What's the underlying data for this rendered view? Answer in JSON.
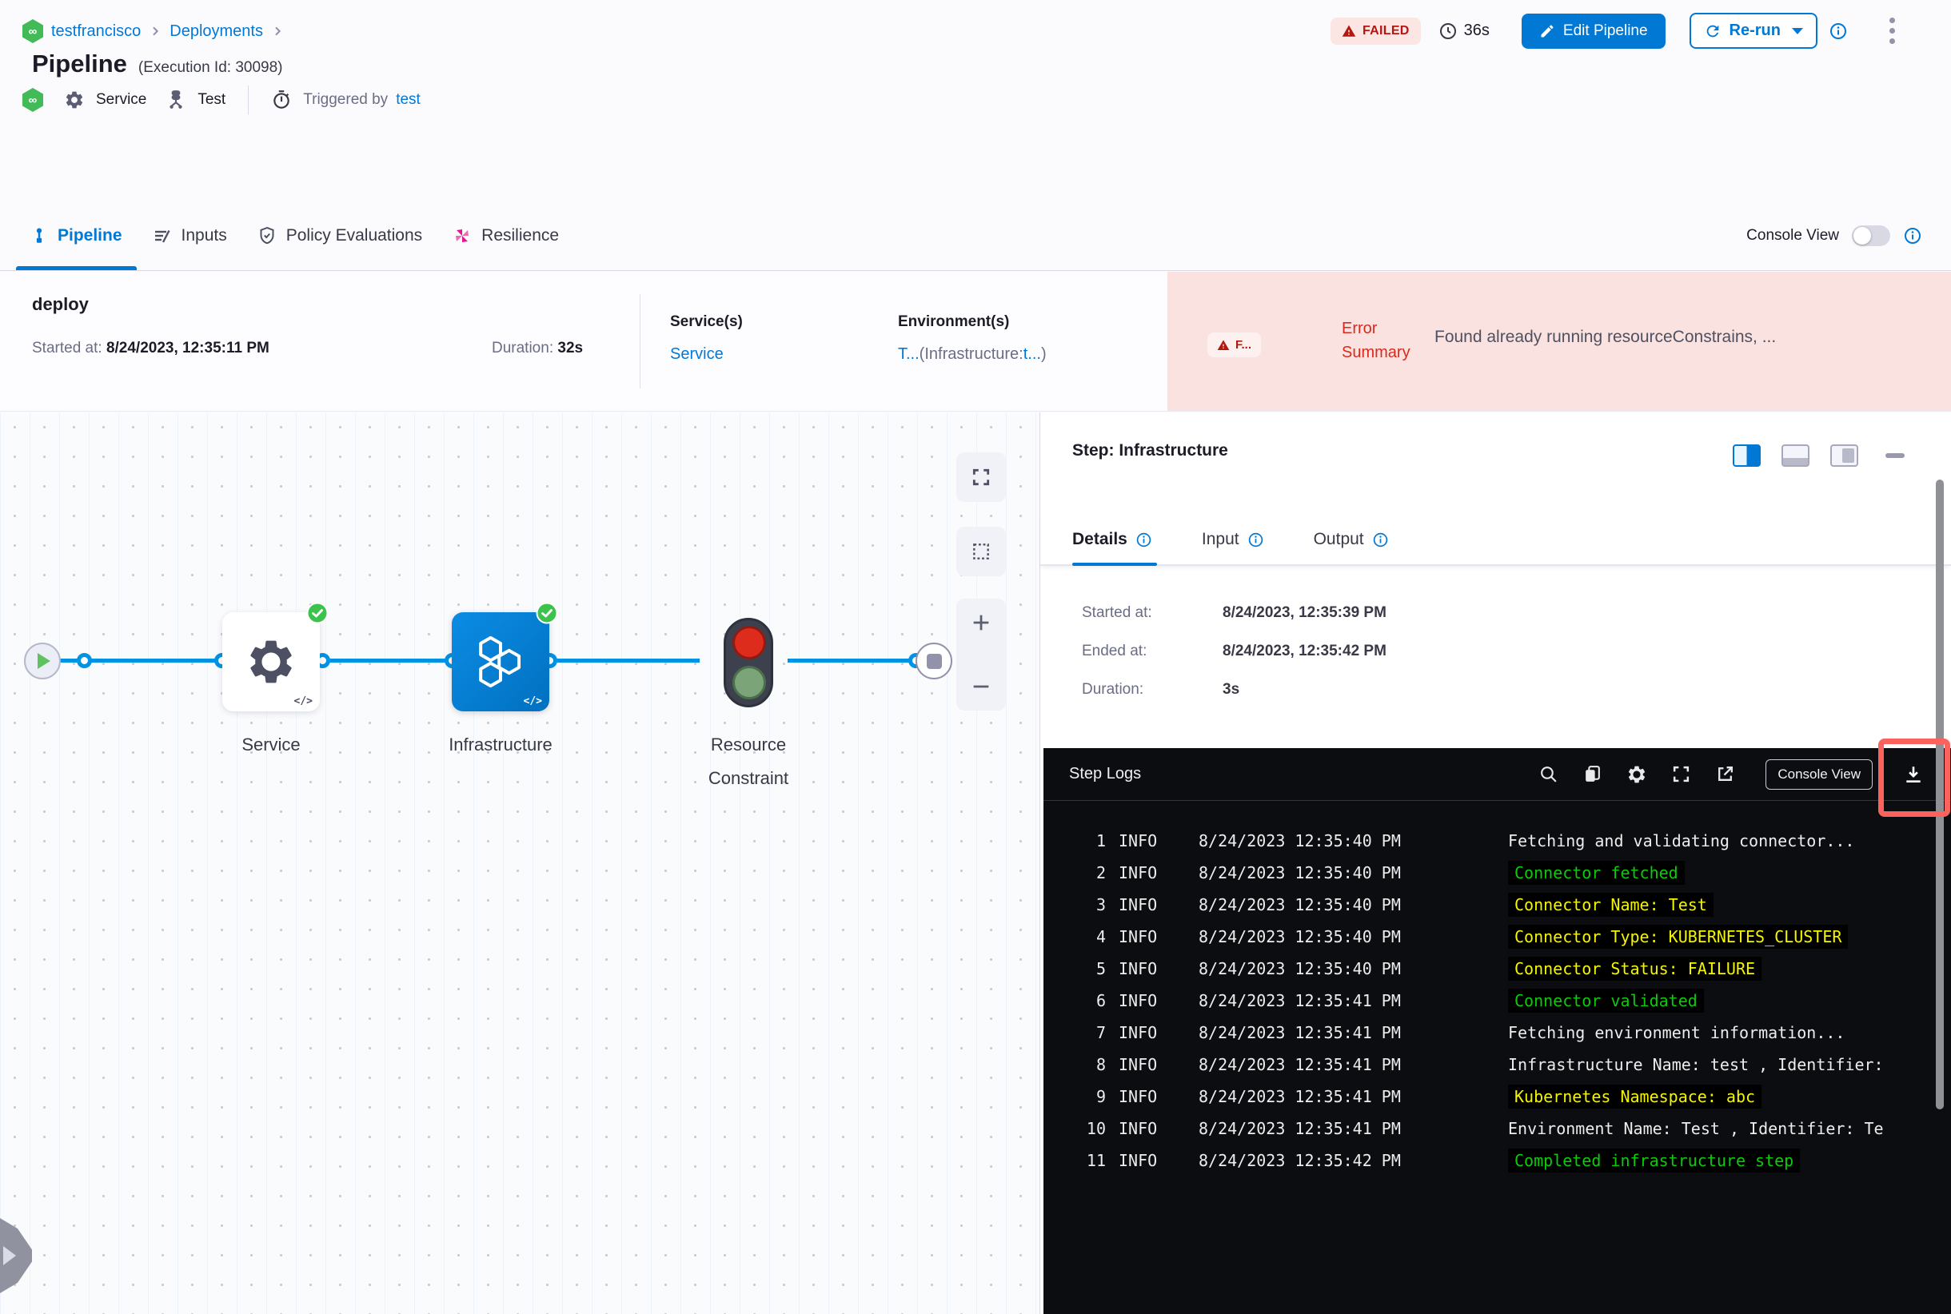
{
  "colors": {
    "primary_blue": "#0278d5",
    "edge_blue": "#0092e4",
    "failed_red": "#b41710",
    "failed_bg": "#fbe6e4",
    "error_region_bg": "#f9e2df",
    "success_green": "#3dc34d",
    "harness_green": "#42ba57",
    "resilience_pink": "#e1158c",
    "console_bg": "#0b0d10",
    "console_green": "#0acc0a",
    "console_yellow": "#f5f500",
    "annotation_red": "#f9625d"
  },
  "breadcrumb": {
    "project": "testfrancisco",
    "section": "Deployments",
    "infinity_glyph": "∞"
  },
  "header": {
    "title": "Pipeline",
    "execution_id": "(Execution Id: 30098)",
    "status": "FAILED",
    "elapsed": "36s",
    "edit_button": "Edit Pipeline",
    "rerun_button": "Re-run",
    "service_label": "Service",
    "test_label": "Test",
    "triggered_by_label": "Triggered by",
    "triggered_by_user": "test"
  },
  "tabs": [
    {
      "label": "Pipeline"
    },
    {
      "label": "Inputs"
    },
    {
      "label": "Policy Evaluations"
    },
    {
      "label": "Resilience"
    }
  ],
  "console_view_label": "Console View",
  "summary": {
    "stage_name": "deploy",
    "started_label": "Started at:",
    "started_value": "8/24/2023, 12:35:11 PM",
    "duration_label": "Duration:",
    "duration_value": "32s",
    "services_label": "Service(s)",
    "services_value": "Service",
    "environments_label": "Environment(s)",
    "env_value_prefix": "T...",
    "env_value_mid": "(Infrastructure:",
    "env_value_link": "t...",
    "env_value_suffix": ")",
    "failed_short": "F...",
    "error_summary_label": "Error Summary",
    "error_summary_text": "Found already running resourceConstrains, ..."
  },
  "graph": {
    "nodes": [
      {
        "label": "Service"
      },
      {
        "label": "Infrastructure"
      },
      {
        "label": "Resource Constraint"
      }
    ],
    "code_glyph": "</>"
  },
  "step_panel": {
    "title": "Step: Infrastructure",
    "tabs": [
      {
        "label": "Details"
      },
      {
        "label": "Input"
      },
      {
        "label": "Output"
      }
    ],
    "details": {
      "started_label": "Started at:",
      "started_value": "8/24/2023, 12:35:39 PM",
      "ended_label": "Ended at:",
      "ended_value": "8/24/2023, 12:35:42 PM",
      "duration_label": "Duration:",
      "duration_value": "3s"
    },
    "logs_title": "Step Logs",
    "console_view_button": "Console View",
    "logs": [
      {
        "n": "1",
        "level": "INFO",
        "ts": "8/24/2023 12:35:40 PM",
        "msg": "Fetching and validating connector...",
        "color": "white"
      },
      {
        "n": "2",
        "level": "INFO",
        "ts": "8/24/2023 12:35:40 PM",
        "msg": "Connector fetched",
        "color": "green"
      },
      {
        "n": "3",
        "level": "INFO",
        "ts": "8/24/2023 12:35:40 PM",
        "msg": "Connector Name: Test",
        "color": "yellow"
      },
      {
        "n": "4",
        "level": "INFO",
        "ts": "8/24/2023 12:35:40 PM",
        "msg": "Connector Type: KUBERNETES_CLUSTER",
        "color": "yellow"
      },
      {
        "n": "5",
        "level": "INFO",
        "ts": "8/24/2023 12:35:40 PM",
        "msg": "Connector Status: FAILURE",
        "color": "yellow"
      },
      {
        "n": "6",
        "level": "INFO",
        "ts": "8/24/2023 12:35:41 PM",
        "msg": "Connector validated",
        "color": "green"
      },
      {
        "n": "7",
        "level": "INFO",
        "ts": "8/24/2023 12:35:41 PM",
        "msg": "Fetching environment information...",
        "color": "white"
      },
      {
        "n": "8",
        "level": "INFO",
        "ts": "8/24/2023 12:35:41 PM",
        "msg": "Infrastructure Name: test , Identifier:",
        "color": "white"
      },
      {
        "n": "9",
        "level": "INFO",
        "ts": "8/24/2023 12:35:41 PM",
        "msg": "Kubernetes Namespace: abc",
        "color": "yellow"
      },
      {
        "n": "10",
        "level": "INFO",
        "ts": "8/24/2023 12:35:41 PM",
        "msg": "Environment Name: Test , Identifier: Te",
        "color": "white"
      },
      {
        "n": "11",
        "level": "INFO",
        "ts": "8/24/2023 12:35:42 PM",
        "msg": "Completed infrastructure step",
        "color": "green"
      }
    ]
  }
}
